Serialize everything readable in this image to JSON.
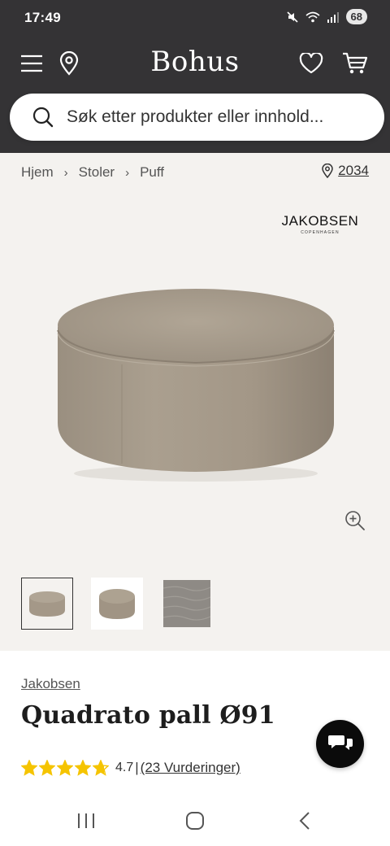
{
  "status": {
    "time": "17:49",
    "battery": "68"
  },
  "header": {
    "logo": "Bohus"
  },
  "search": {
    "placeholder": "Søk etter produkter eller innhold..."
  },
  "breadcrumb": {
    "items": [
      "Hjem",
      "Stoler",
      "Puff"
    ]
  },
  "store": {
    "number": "2034"
  },
  "brand_logo": {
    "name": "JAKOBSEN",
    "sub": "COPENHAGEN"
  },
  "product": {
    "brand": "Jakobsen",
    "title": "Quadrato pall Ø91",
    "rating": "4.7",
    "rating_fraction": 0.94,
    "separator": "|",
    "reviews": "(23 Vurderinger)"
  },
  "colors": {
    "header_bg": "#343335",
    "star": "#f5c400",
    "fabric": "#a59988",
    "page_bg": "#f4f2ef"
  },
  "icons": [
    "menu-icon",
    "location-pin-icon",
    "heart-icon",
    "cart-icon",
    "search-icon",
    "zoom-in-icon",
    "chat-icon",
    "star-icon",
    "recents-icon",
    "home-icon",
    "back-icon"
  ]
}
